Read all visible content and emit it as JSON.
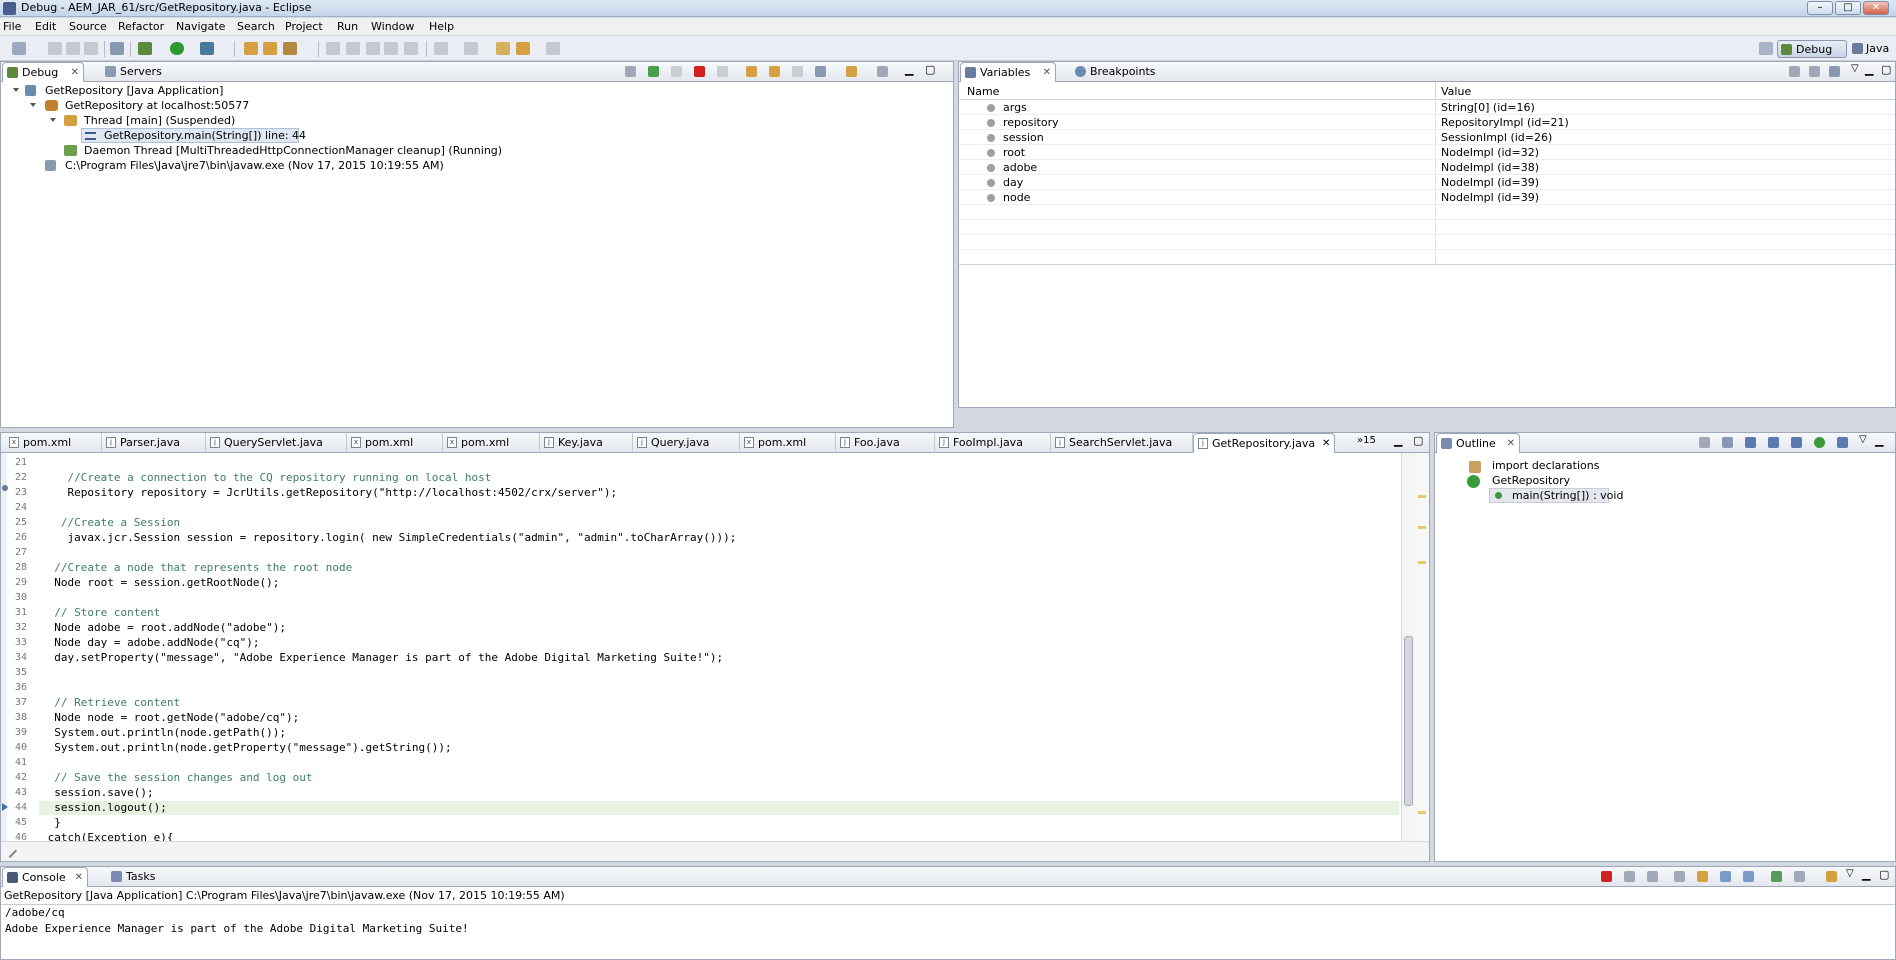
{
  "window": {
    "title": "Debug - AEM_JAR_61/src/GetRepository.java - Eclipse",
    "min": "–",
    "max": "□",
    "close": "✕"
  },
  "menu": [
    "File",
    "Edit",
    "Source",
    "Refactor",
    "Navigate",
    "Search",
    "Project",
    "Run",
    "Window",
    "Help"
  ],
  "perspectives": {
    "debug": "Debug",
    "java": "Java"
  },
  "debug_view": {
    "tabs": [
      "Debug",
      "Servers"
    ],
    "tree": [
      {
        "label": "GetRepository [Java Application]"
      },
      {
        "label": "GetRepository at localhost:50577"
      },
      {
        "label": "Thread [main] (Suspended)"
      },
      {
        "label": "GetRepository.main(String[]) line: 44"
      },
      {
        "label": "Daemon Thread [MultiThreadedHttpConnectionManager cleanup] (Running)"
      },
      {
        "label": "C:\\Program Files\\Java\\jre7\\bin\\javaw.exe (Nov 17, 2015 10:19:55 AM)"
      }
    ]
  },
  "variables_view": {
    "tabs": [
      "Variables",
      "Breakpoints"
    ],
    "columns": [
      "Name",
      "Value"
    ],
    "rows": [
      {
        "name": "args",
        "value": "String[0]  (id=16)"
      },
      {
        "name": "repository",
        "value": "RepositoryImpl  (id=21)"
      },
      {
        "name": "session",
        "value": "SessionImpl  (id=26)"
      },
      {
        "name": "root",
        "value": "NodeImpl  (id=32)"
      },
      {
        "name": "adobe",
        "value": "NodeImpl  (id=38)"
      },
      {
        "name": "day",
        "value": "NodeImpl  (id=39)"
      },
      {
        "name": "node",
        "value": "NodeImpl  (id=39)"
      }
    ]
  },
  "editor": {
    "tabs": [
      {
        "label": "pom.xml",
        "icon": "x"
      },
      {
        "label": "Parser.java",
        "icon": "j"
      },
      {
        "label": "QueryServlet.java",
        "icon": "j"
      },
      {
        "label": "pom.xml",
        "icon": "x"
      },
      {
        "label": "pom.xml",
        "icon": "x"
      },
      {
        "label": "Key.java",
        "icon": "j"
      },
      {
        "label": "Query.java",
        "icon": "j"
      },
      {
        "label": "pom.xml",
        "icon": "x"
      },
      {
        "label": "Foo.java",
        "icon": "j"
      },
      {
        "label": "FooImpl.java",
        "icon": "j"
      },
      {
        "label": "SearchServlet.java",
        "icon": "j"
      },
      {
        "label": "GetRepository.java",
        "icon": "j"
      }
    ],
    "overflow": "»15",
    "lines": [
      {
        "n": "21",
        "t": ""
      },
      {
        "n": "22",
        "t": "    //Create a connection to the CQ repository running on local host"
      },
      {
        "n": "23",
        "t": "    Repository repository = JcrUtils.getRepository(\"http://localhost:4502/crx/server\");"
      },
      {
        "n": "24",
        "t": ""
      },
      {
        "n": "25",
        "t": "   //Create a Session"
      },
      {
        "n": "26",
        "t": "    javax.jcr.Session session = repository.login( new SimpleCredentials(\"admin\", \"admin\".toCharArray()));"
      },
      {
        "n": "27",
        "t": ""
      },
      {
        "n": "28",
        "t": "  //Create a node that represents the root node"
      },
      {
        "n": "29",
        "t": "  Node root = session.getRootNode();"
      },
      {
        "n": "30",
        "t": ""
      },
      {
        "n": "31",
        "t": "  // Store content"
      },
      {
        "n": "32",
        "t": "  Node adobe = root.addNode(\"adobe\");"
      },
      {
        "n": "33",
        "t": "  Node day = adobe.addNode(\"cq\");"
      },
      {
        "n": "34",
        "t": "  day.setProperty(\"message\", \"Adobe Experience Manager is part of the Adobe Digital Marketing Suite!\");"
      },
      {
        "n": "35",
        "t": ""
      },
      {
        "n": "36",
        "t": ""
      },
      {
        "n": "37",
        "t": "  // Retrieve content"
      },
      {
        "n": "38",
        "t": "  Node node = root.getNode(\"adobe/cq\");"
      },
      {
        "n": "39",
        "t": "  System.out.println(node.getPath());"
      },
      {
        "n": "40",
        "t": "  System.out.println(node.getProperty(\"message\").getString());"
      },
      {
        "n": "41",
        "t": ""
      },
      {
        "n": "42",
        "t": "  // Save the session changes and log out"
      },
      {
        "n": "43",
        "t": "  session.save();"
      },
      {
        "n": "44",
        "t": "  session.logout();"
      },
      {
        "n": "45",
        "t": "  }"
      },
      {
        "n": "46",
        "t": " catch(Exception e){"
      }
    ]
  },
  "outline_view": {
    "tab": "Outline",
    "items": [
      {
        "label": "import declarations"
      },
      {
        "label": "GetRepository"
      },
      {
        "label": "main(String[]) : void"
      }
    ]
  },
  "console_view": {
    "tabs": [
      "Console",
      "Tasks"
    ],
    "header": "GetRepository [Java Application] C:\\Program Files\\Java\\jre7\\bin\\javaw.exe (Nov 17, 2015 10:19:55 AM)",
    "output": [
      "/adobe/cq",
      "Adobe Experience Manager is part of the Adobe Digital Marketing Suite!"
    ]
  }
}
